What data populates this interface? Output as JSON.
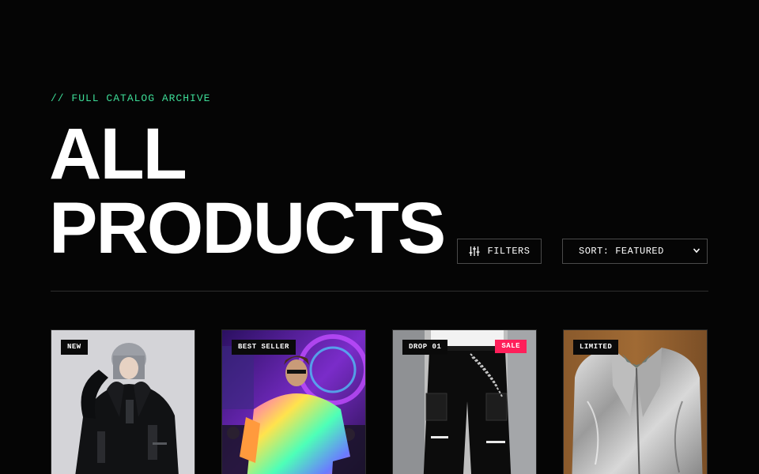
{
  "header": {
    "eyebrow": "// FULL CATALOG ARCHIVE",
    "title_line1": "ALL",
    "title_line2": "PRODUCTS"
  },
  "toolbar": {
    "filters_label": "FILTERS",
    "filters_icon": "sliders-icon",
    "sort_value": "SORT: FEATURED",
    "sort_icon": "chevron-down-icon"
  },
  "colors": {
    "background": "#050505",
    "accent": "#3ddc97",
    "sale": "#ff1f5a",
    "border": "#4a4a4a"
  },
  "products": [
    {
      "badge": "NEW",
      "image": "black techwear oversized hoodie on model"
    },
    {
      "badge": "BEST SELLER",
      "image": "rainbow psychedelic tee at festival"
    },
    {
      "badge": "DROP 01",
      "sale_badge": "SALE",
      "image": "black cargo pants with chains"
    },
    {
      "badge": "LIMITED",
      "image": "silver metallic leather jacket"
    }
  ]
}
